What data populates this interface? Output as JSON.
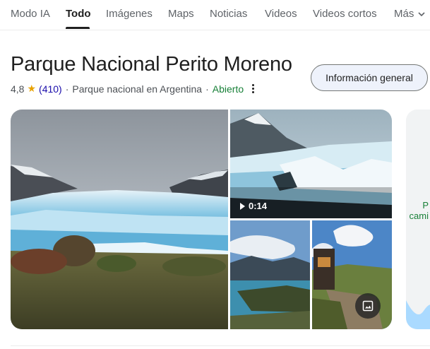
{
  "tabs": [
    {
      "label": "Modo IA"
    },
    {
      "label": "Todo"
    },
    {
      "label": "Imágenes"
    },
    {
      "label": "Maps"
    },
    {
      "label": "Noticias"
    },
    {
      "label": "Videos"
    },
    {
      "label": "Videos cortos"
    },
    {
      "label": "Más"
    }
  ],
  "header": {
    "title": "Parque Nacional Perito Moreno",
    "rating": "4,8",
    "star_icon": "star-icon",
    "review_count": "(410)",
    "category": "Parque nacional en Argentina",
    "separator": "·",
    "status": "Abierto",
    "info_button": "Información general"
  },
  "gallery": {
    "video_duration": "0:14",
    "side_text_line1": "P",
    "side_text_line2": "cami"
  },
  "colors": {
    "link": "#1a0dab",
    "open": "#188038",
    "star": "#e8a200",
    "accent_button_bg": "#eef2fb"
  }
}
